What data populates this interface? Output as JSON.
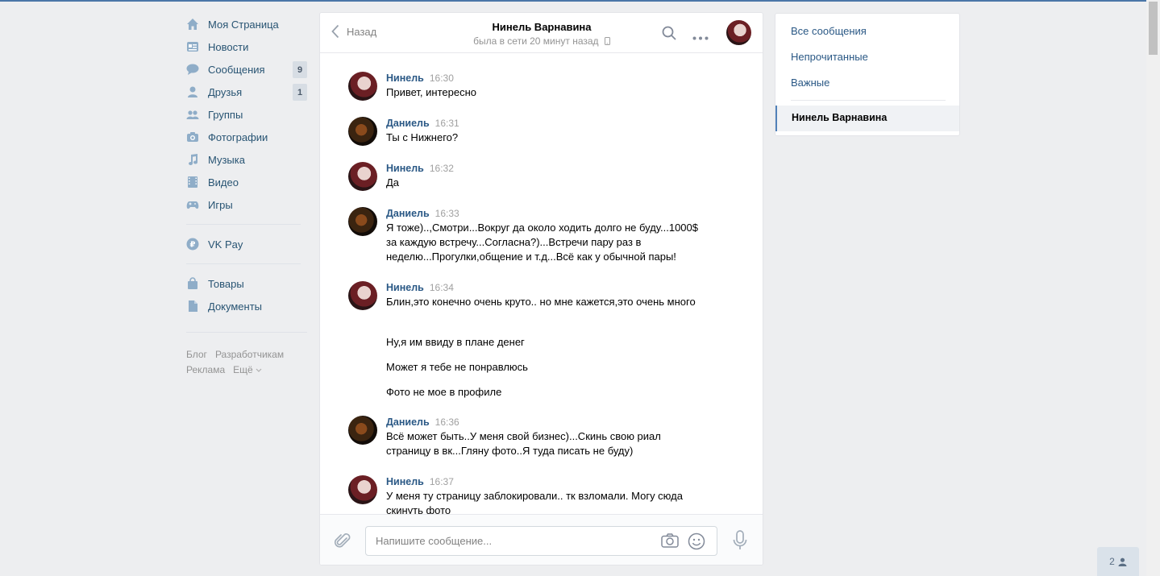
{
  "nav": {
    "items": [
      {
        "label": "Моя Страница",
        "icon": "home-icon"
      },
      {
        "label": "Новости",
        "icon": "news-icon"
      },
      {
        "label": "Сообщения",
        "icon": "messages-icon",
        "count": "9"
      },
      {
        "label": "Друзья",
        "icon": "friends-icon",
        "count": "1"
      },
      {
        "label": "Группы",
        "icon": "groups-icon"
      },
      {
        "label": "Фотографии",
        "icon": "photos-icon"
      },
      {
        "label": "Музыка",
        "icon": "music-icon"
      },
      {
        "label": "Видео",
        "icon": "video-icon"
      },
      {
        "label": "Игры",
        "icon": "games-icon"
      },
      {
        "label": "VK Pay",
        "icon": "vkpay-icon"
      },
      {
        "label": "Товары",
        "icon": "market-icon"
      },
      {
        "label": "Документы",
        "icon": "docs-icon"
      }
    ],
    "footer": [
      "Блог",
      "Разработчикам",
      "Реклама",
      "Ещё"
    ]
  },
  "chat": {
    "back_label": "Назад",
    "peer_name": "Нинель Варнавина",
    "peer_status": "была в сети 20 минут назад",
    "messages": [
      {
        "author": "Нинель",
        "time": "16:30",
        "text": "Привет, интересно"
      },
      {
        "author": "Даниель",
        "time": "16:31",
        "text": "Ты с Нижнего?"
      },
      {
        "author": "Нинель",
        "time": "16:32",
        "text": "Да"
      },
      {
        "author": "Даниель",
        "time": "16:33",
        "text": "Я тоже)..,Смотри...Вокруг да около ходить долго не буду...1000$ за каждую встречу...Согласна?)...Встречи пару раз в неделю...Прогулки,общение и т.д...Всё как у обычной пары!"
      },
      {
        "author": "Нинель",
        "time": "16:34",
        "text": "Блин,это конечно очень круто.. но мне кажется,это очень много"
      },
      {
        "author": "Даниель",
        "time": "16:36",
        "text": "Всё может быть..У меня свой бизнес)...Скинь свою риал страницу в вк...Гляну фото..Я туда писать не буду)"
      },
      {
        "author": "Нинель",
        "time": "16:37",
        "text": "У меня ту страницу заблокировали.. тк взломали. Могу сюда скинуть фото"
      }
    ],
    "extra_lines": [
      "Ну,я им ввиду в плане денег",
      "Может я тебе не понравлюсь",
      "Фото не мое в профиле"
    ],
    "composer_placeholder": "Напишите сообщение..."
  },
  "filters": {
    "all": "Все сообщения",
    "unread": "Непрочитанные",
    "important": "Важные",
    "active_chat": "Нинель Варнавина"
  },
  "friends_online": "2",
  "colors": {
    "accent": "#4a76a8",
    "link": "#2a5885",
    "background": "#edeef0"
  }
}
